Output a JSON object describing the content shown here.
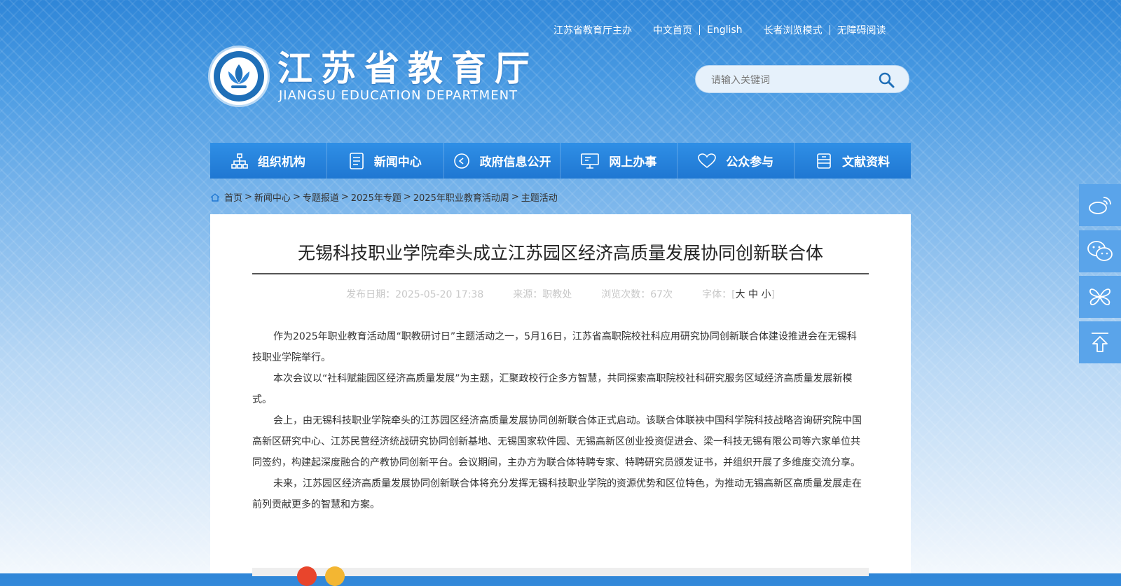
{
  "top_links": {
    "host": "江苏省教育厅主办",
    "home_cn": "中文首页",
    "english": "English",
    "elder_mode": "长者浏览模式",
    "accessible": "无障碍阅读"
  },
  "brand": {
    "title": "江苏省教育厅",
    "subtitle": "JIANGSU EDUCATION DEPARTMENT",
    "logo_icon": "jiangsu-education-emblem"
  },
  "search": {
    "placeholder": "请输入关键词",
    "icon": "search-icon"
  },
  "nav": {
    "items": [
      {
        "label": "组织机构",
        "icon": "org-chart-icon"
      },
      {
        "label": "新闻中心",
        "icon": "document-icon"
      },
      {
        "label": "政府信息公开",
        "icon": "info-open-icon"
      },
      {
        "label": "网上办事",
        "icon": "monitor-icon"
      },
      {
        "label": "公众参与",
        "icon": "heart-icon"
      },
      {
        "label": "文献资料",
        "icon": "archive-icon"
      }
    ]
  },
  "breadcrumb": {
    "items": [
      "首页",
      "新闻中心",
      "专题报道",
      "2025年专题",
      "2025年职业教育活动周",
      "主题活动"
    ],
    "separator": ">"
  },
  "article": {
    "title": "无锡科技职业学院牵头成立江苏园区经济高质量发展协同创新联合体",
    "date_label": "发布日期：",
    "date": "2025-05-20 17:38",
    "source_label": "来源：",
    "source": "职教处",
    "views_label": "浏览次数：",
    "views": "67次",
    "font_label": "字体：",
    "font_open": "[",
    "font_large": "大",
    "font_medium": "中",
    "font_small": "小",
    "font_close": "]",
    "paragraphs": [
      "作为2025年职业教育活动周“职教研讨日”主题活动之一，5月16日，江苏省高职院校社科应用研究协同创新联合体建设推进会在无锡科技职业学院举行。",
      "本次会议以“社科赋能园区经济高质量发展”为主题，汇聚政校行企多方智慧，共同探索高职院校社科研究服务区域经济高质量发展新模式。",
      "会上，由无锡科技职业学院牵头的江苏园区经济高质量发展协同创新联合体正式启动。该联合体联袂中国科学院科技战略咨询研究院中国高新区研究中心、江苏民营经济统战研究协同创新基地、无锡国家软件园、无锡高新区创业投资促进会、梁一科技无锡有限公司等六家单位共同签约，构建起深度融合的产教协同创新平台。会议期间，主办方为联合体特聘专家、特聘研究员颁发证书，并组织开展了多维度交流分享。",
      "未来，江苏园区经济高质量发展协同创新联合体将充分发挥无锡科技职业学院的资源优势和区位特色，为推动无锡高新区高质量发展走在前列贡献更多的智慧和方案。"
    ]
  },
  "side_tools": [
    {
      "icon": "weibo-icon"
    },
    {
      "icon": "wechat-icon"
    },
    {
      "icon": "butterfly-icon"
    },
    {
      "icon": "back-to-top-icon"
    }
  ],
  "colors": {
    "nav_bg": "#1f77d2",
    "side_bg": "#5aa4ea",
    "share_red": "#e8452c",
    "share_yellow": "#f3b632"
  }
}
